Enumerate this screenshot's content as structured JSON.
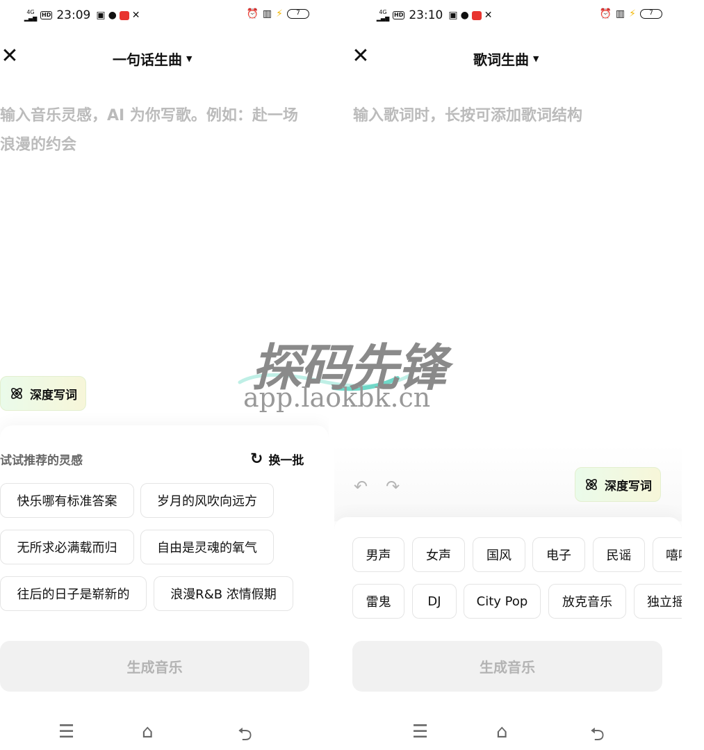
{
  "left": {
    "status": {
      "network": "4G",
      "time": "23:09",
      "battery": "7"
    },
    "mode_title": "一句话生曲",
    "placeholder": "输入音乐灵感，AI 为你写歌。例如：赴一场浪漫的约会",
    "deep_write_label": "深度写词",
    "inspire_label": "试试推荐的灵感",
    "refresh_label": "换一批",
    "suggestions": [
      "快乐哪有标准答案",
      "岁月的风吹向远方",
      "无所求必满载而归",
      "自由是灵魂的氧气",
      "往后的日子是崭新的",
      "浪漫R&B 浓情假期"
    ],
    "generate_label": "生成音乐"
  },
  "right": {
    "status": {
      "network": "4G",
      "time": "23:10",
      "battery": "7"
    },
    "mode_title": "歌词生曲",
    "placeholder": "输入歌词时，长按可添加歌词结构",
    "deep_write_label": "深度写词",
    "style_row1": [
      "男声",
      "女声",
      "国风",
      "电子",
      "民谣",
      "嘻哈"
    ],
    "style_row2": [
      "雷鬼",
      "DJ",
      "City Pop",
      "放克音乐",
      "独立摇滚"
    ],
    "generate_label": "生成音乐"
  },
  "watermark": {
    "brand": "探码先锋",
    "url": "app.laokbk.cn"
  },
  "colors": {
    "accent_green": "#eafbea",
    "placeholder_gray": "#bbbbbb",
    "button_gray": "#f1f1f1"
  }
}
